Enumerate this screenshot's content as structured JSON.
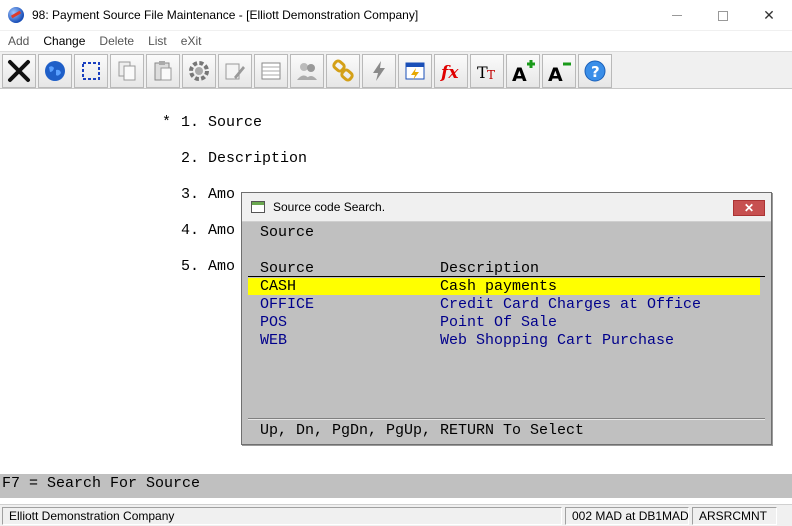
{
  "window": {
    "title": "98: Payment Source File Maintenance - [Elliott Demonstration Company]",
    "close_glyph": "✕"
  },
  "menu": [
    {
      "label": "Add"
    },
    {
      "label": "Change"
    },
    {
      "label": "Delete"
    },
    {
      "label": "List"
    },
    {
      "label": "eXit"
    }
  ],
  "toolbar": [
    {
      "icon": "close-icon"
    },
    {
      "icon": "globe-icon"
    },
    {
      "icon": "select-icon"
    },
    {
      "icon": "copy-icon"
    },
    {
      "icon": "paste-icon"
    },
    {
      "icon": "gear-icon"
    },
    {
      "icon": "edit-icon"
    },
    {
      "icon": "grid-icon"
    },
    {
      "icon": "users-icon"
    },
    {
      "icon": "chain-icon"
    },
    {
      "icon": "lightning-icon"
    },
    {
      "icon": "calendar-icon"
    },
    {
      "icon": "function-icon"
    },
    {
      "icon": "font-size-icon"
    },
    {
      "icon": "font-increase-icon"
    },
    {
      "icon": "font-decrease-icon"
    },
    {
      "icon": "help-icon"
    }
  ],
  "fields": [
    {
      "marker": "*",
      "number": "1.",
      "label": "Source"
    },
    {
      "marker": "",
      "number": "2.",
      "label": "Description"
    },
    {
      "marker": "",
      "number": "3.",
      "label": "Amo"
    },
    {
      "marker": "",
      "number": "4.",
      "label": "Amo"
    },
    {
      "marker": "",
      "number": "5.",
      "label": "Amo"
    }
  ],
  "dialog": {
    "title": "Source code Search.",
    "close_glyph": "✕",
    "prompt": "Source",
    "columns": {
      "code": "Source",
      "description": "Description"
    },
    "results": [
      {
        "code": "CASH",
        "description": "Cash payments",
        "selected": true
      },
      {
        "code": "OFFICE",
        "description": "Credit Card Charges at Office",
        "selected": false
      },
      {
        "code": "POS",
        "description": "Point Of Sale",
        "selected": false
      },
      {
        "code": "WEB",
        "description": "Web Shopping Cart Purchase",
        "selected": false
      }
    ],
    "footer": "Up, Dn, PgDn, PgUp, RETURN To Select"
  },
  "help_line": "F7 = Search For Source",
  "status": {
    "company": "Elliott Demonstration Company",
    "location": "002 MAD at DB1MAD",
    "program": "ARSRCMNT"
  },
  "colors": {
    "highlight": "#ffff00",
    "result_text": "#00008b",
    "panel_gray": "#c0c0c0"
  }
}
